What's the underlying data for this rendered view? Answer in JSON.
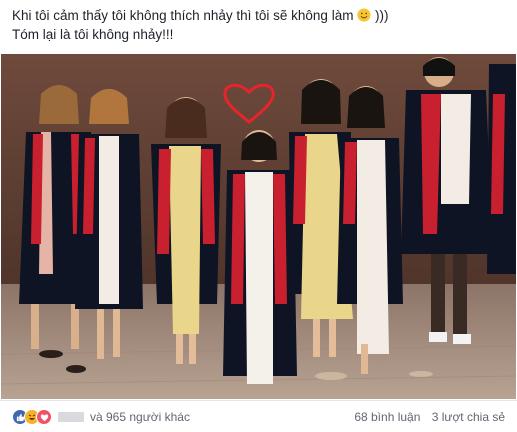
{
  "post": {
    "caption_line1": "Khi tôi cảm thấy tôi không thích nhảy thì tôi sẽ không làm",
    "caption_line1_suffix": ")))",
    "caption_line2": "Tóm lại là tôi không nhảy!!!"
  },
  "footer": {
    "reactions": [
      "like-icon",
      "haha-icon",
      "love-icon"
    ],
    "others_text": "và 965 người khác",
    "comments": "68 bình luận",
    "shares": "3 lượt chia sẻ"
  },
  "colors": {
    "like": "#4267b2",
    "haha": "#f7b125",
    "love": "#f25268",
    "heart_doodle": "#e8242b",
    "gown": "#0e1424",
    "stole": "#c8202e"
  }
}
